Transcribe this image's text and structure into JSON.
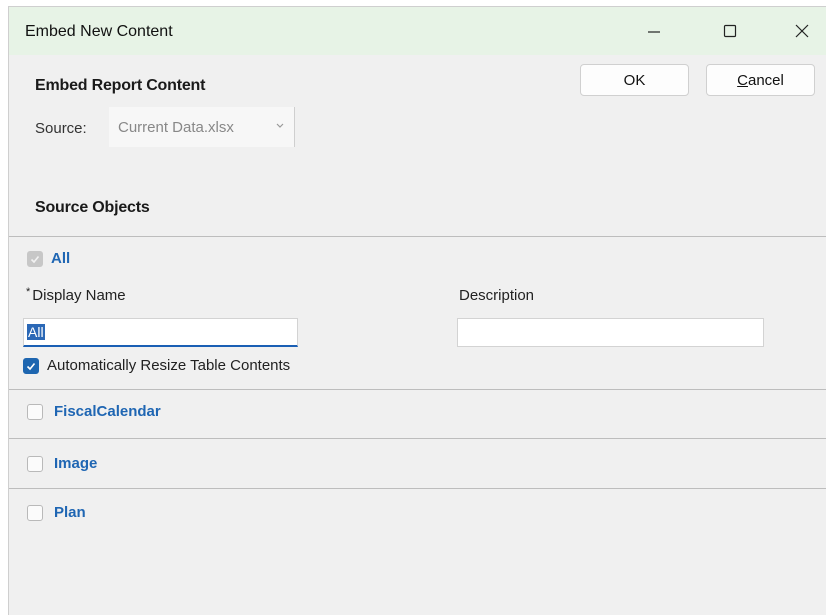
{
  "window": {
    "title": "Embed New Content"
  },
  "titlebar_controls": {
    "minimize_icon": "minimize-icon",
    "maximize_icon": "maximize-icon",
    "close_icon": "close-icon"
  },
  "embed_section": {
    "heading": "Embed Report Content",
    "source_label": "Source:",
    "source_value": "Current Data.xlsx"
  },
  "buttons": {
    "ok_label": "OK",
    "cancel_first": "C",
    "cancel_rest": "ancel"
  },
  "source_objects": {
    "heading": "Source Objects",
    "items": [
      {
        "label": "All",
        "state": "disabled-checked"
      },
      {
        "label": "FiscalCalendar",
        "state": "unchecked"
      },
      {
        "label": "Image",
        "state": "unchecked"
      },
      {
        "label": "Plan",
        "state": "unchecked"
      }
    ],
    "all_details": {
      "required_mark": "*",
      "display_name_label": "Display Name",
      "display_name_value": "All",
      "description_label": "Description",
      "description_value": "",
      "auto_resize_label": "Automatically Resize Table Contents",
      "auto_resize_checked": true
    }
  },
  "colors": {
    "titlebar_bg": "#e7f3e6",
    "accent_blue": "#1e66b0",
    "link_blue": "#1f66b3",
    "window_bg": "#f0f0f0"
  }
}
